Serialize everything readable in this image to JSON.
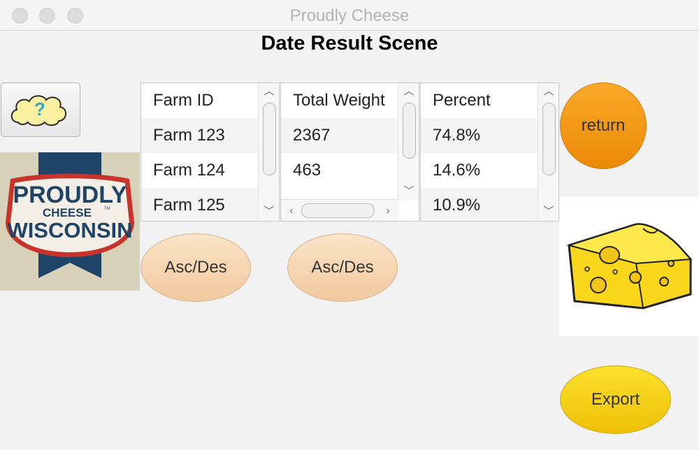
{
  "window": {
    "title": "Proudly Cheese"
  },
  "scene_title": "Date Result Scene",
  "logo": {
    "line1": "PROUDLY",
    "line2": "CHEESE",
    "line3": "WISCONSIN",
    "tm": "TM"
  },
  "tables": {
    "farm": {
      "header": "Farm ID",
      "rows": [
        "Farm 123",
        "Farm 124",
        "Farm 125"
      ]
    },
    "weight": {
      "header": "Total Weight",
      "rows": [
        "2367",
        "463"
      ]
    },
    "percent": {
      "header": "Percent",
      "rows": [
        "74.8%",
        "14.6%",
        "10.9%"
      ]
    }
  },
  "buttons": {
    "help_symbol": "?",
    "asc_des_1": "Asc/Des",
    "asc_des_2": "Asc/Des",
    "return": "return",
    "export": "Export"
  },
  "colors": {
    "return": "#f39a10",
    "export": "#f6d21a",
    "asc_des": "#f6d7b4"
  },
  "icons": [
    "help-cloud-icon",
    "cheese-icon",
    "proudly-wisconsin-cheese-logo"
  ]
}
